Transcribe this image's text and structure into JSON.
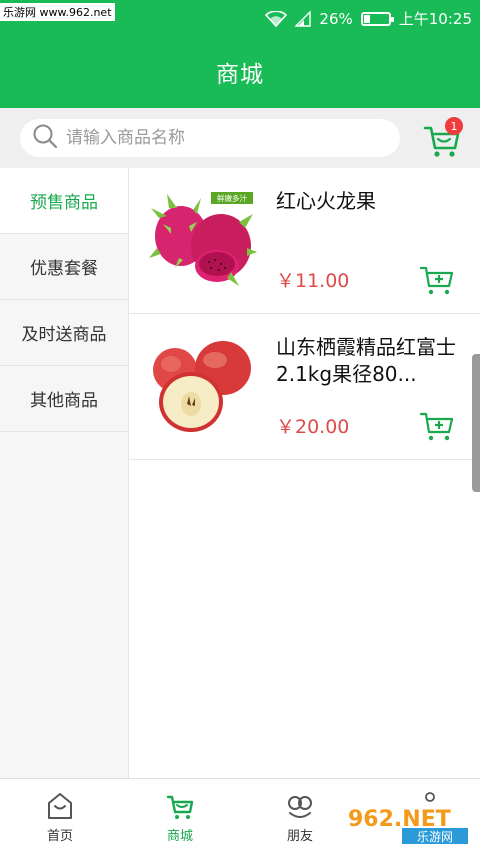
{
  "status_bar": {
    "watermark": "乐游网 www.962.net",
    "battery": "26%",
    "battery_level": 0.26,
    "time": "上午10:25"
  },
  "header": {
    "title": "商城"
  },
  "search": {
    "placeholder": "请输入商品名称"
  },
  "cart": {
    "badge": "1"
  },
  "categories": [
    {
      "label": "预售商品",
      "active": true
    },
    {
      "label": "优惠套餐",
      "active": false
    },
    {
      "label": "及时送商品",
      "active": false
    },
    {
      "label": "其他商品",
      "active": false
    }
  ],
  "products": [
    {
      "name": "红心火龙果",
      "price": "￥11.00",
      "image": "dragon-fruit",
      "image_tag": "鲜嫩多汁"
    },
    {
      "name": "山东栖霞精品红富士2.1kg果径80...",
      "price": "￥20.00",
      "image": "red-apple"
    }
  ],
  "tabs": [
    {
      "label": "首页",
      "icon": "home-bag-icon",
      "active": false
    },
    {
      "label": "商城",
      "icon": "cart-icon",
      "active": true
    },
    {
      "label": "朋友",
      "icon": "friends-icon",
      "active": false
    },
    {
      "label": "",
      "icon": "profile-icon",
      "active": false
    }
  ],
  "watermark_logo": {
    "text": "962.NET",
    "subtext": "乐游网"
  },
  "colors": {
    "brand_green": "#18bb55",
    "active_green": "#18a84e",
    "price_red": "#e04a4a",
    "badge_red": "#f03c3c"
  }
}
